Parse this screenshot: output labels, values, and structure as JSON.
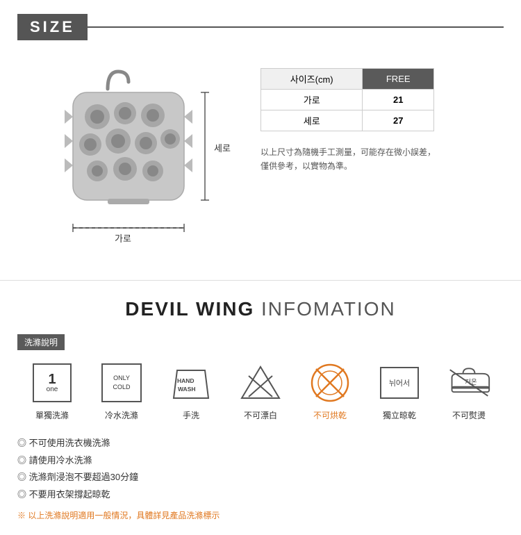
{
  "size_section": {
    "title": "SIZE",
    "header_label_vertical": "세로",
    "header_label_horizontal": "가로",
    "table": {
      "col1": "사이즈(cm)",
      "col2": "FREE",
      "rows": [
        {
          "label": "가로",
          "value": "21"
        },
        {
          "label": "세로",
          "value": "27"
        }
      ]
    },
    "note_line1": "以上尺寸為隨機手工測量，可能存在微小誤差，",
    "note_line2": "僅供參考，以實物為準。"
  },
  "info_section": {
    "title_bold": "DEVIL WING",
    "title_light": "INFOMATION",
    "wash_section_label": "洗滌說明",
    "icons": [
      {
        "id": "single-wash",
        "label": "單獨洗滌",
        "label_color": "normal"
      },
      {
        "id": "cold-wash",
        "label": "冷水洗滌",
        "label_color": "normal"
      },
      {
        "id": "hand-wash",
        "label": "手洗",
        "label_color": "normal"
      },
      {
        "id": "no-bleach",
        "label": "不可漂白",
        "label_color": "normal"
      },
      {
        "id": "no-tumble-dry",
        "label": "不可烘乾",
        "label_color": "orange"
      },
      {
        "id": "hang-dry",
        "label": "獨立晾乾",
        "label_color": "normal"
      },
      {
        "id": "no-iron",
        "label": "不可熨燙",
        "label_color": "normal"
      }
    ],
    "notes": [
      "不可使用洗衣機洗滌",
      "請使用冷水洗滌",
      "洗滌劑浸泡不要超過30分鐘",
      "不要用衣架撐起晾乾"
    ],
    "warning": "※ 以上洗滌說明適用一般情況，具體詳見產品洗滌標示"
  }
}
